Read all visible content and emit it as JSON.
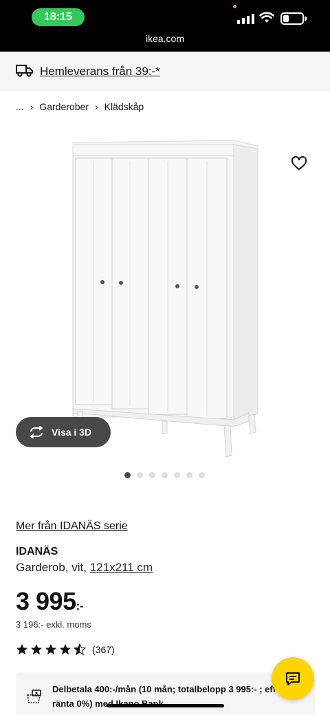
{
  "status_bar": {
    "time": "18:15",
    "url": "ikea.com"
  },
  "delivery_banner": {
    "text": "Hemleverans från 39:-*",
    "icon": "truck-icon"
  },
  "breadcrumb": {
    "more": "...",
    "items": [
      "Garderober",
      "Klädskåp"
    ]
  },
  "gallery": {
    "view_3d_label": "Visa i 3D",
    "dot_count": 7,
    "active_dot": 1,
    "favorite_icon": "heart-icon"
  },
  "product": {
    "series_link": "Mer från IDANÄS serie",
    "name": "IDANÄS",
    "desc_prefix": "Garderob, vit, ",
    "dimensions": "121x211 cm",
    "price": "3 995",
    "price_suffix": ":-",
    "price_excl": "3 196:- exkl. moms",
    "rating_value": 4.5,
    "rating_count": "(367)"
  },
  "finance": {
    "text": "Delbetala 400:-/mån (10 mån; totalbelopp 3 995:- ; eff. ränta 0%) med Ikano Bank"
  },
  "colors": {
    "accent_yellow": "#ffd400",
    "status_green": "#34c759"
  }
}
